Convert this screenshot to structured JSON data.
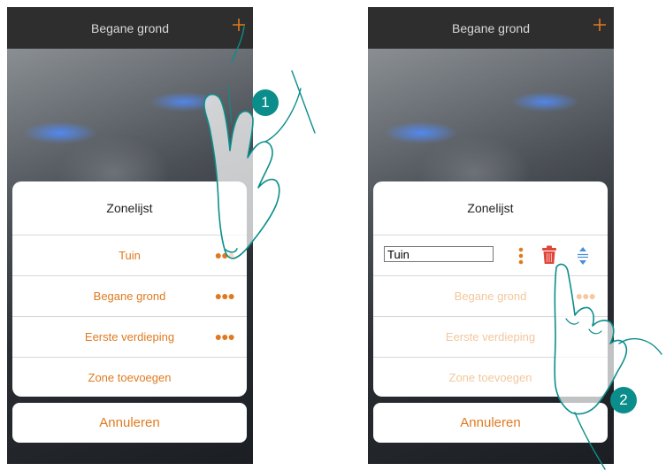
{
  "left_screen": {
    "header_title": "Begane grond",
    "sheet_title": "Zonelijst",
    "zones": [
      {
        "label": "Tuin"
      },
      {
        "label": "Begane grond"
      },
      {
        "label": "Eerste verdieping"
      }
    ],
    "add_zone_label": "Zone toevoegen",
    "cancel_label": "Annuleren",
    "step_badge": "1"
  },
  "right_screen": {
    "header_title": "Begane grond",
    "sheet_title": "Zonelijst",
    "edit_field_value": "Tuin",
    "zones": [
      {
        "label": "Begane grond"
      },
      {
        "label": "Eerste verdieping"
      }
    ],
    "add_zone_label": "Zone toevoegen",
    "cancel_label": "Annuleren",
    "step_badge": "2"
  },
  "icons": {
    "add": "plus-icon",
    "more": "more-options-icon",
    "delete": "trash-icon",
    "reorder": "reorder-icon",
    "hand": "pointing-hand-icon"
  },
  "colors": {
    "accent": "#e07a1f",
    "accent_faded": "#f3c79c",
    "badge": "#0b8d8b",
    "delete": "#e0453a",
    "reorder": "#4a90d9"
  }
}
